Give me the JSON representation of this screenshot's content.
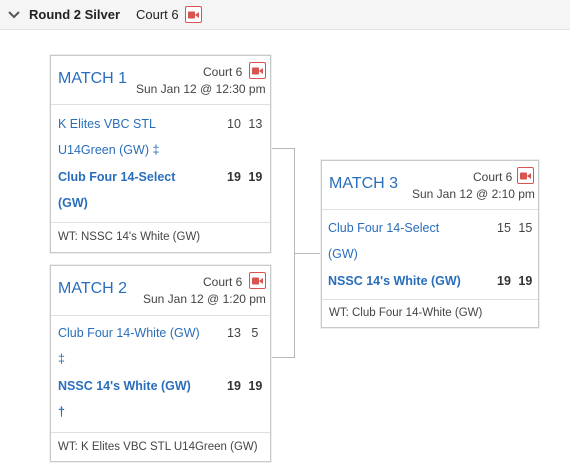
{
  "header": {
    "title": "Round 2 Silver",
    "court": "Court 6",
    "video_icon": "video-camera-icon",
    "accent": "#d9534f"
  },
  "matches": [
    {
      "title": "MATCH 1",
      "court": "Court 6",
      "date": "Sun Jan 12 @ 12:30 pm",
      "team1_line1": "K Elites VBC STL",
      "team1_line2": "U14Green (GW) ‡",
      "team1_s1": "10",
      "team1_s2": "13",
      "team2_line1": "Club Four 14-Select",
      "team2_line2": "(GW)",
      "team2_s1": "19",
      "team2_s2": "19",
      "work_team": "WT: NSSC 14's White (GW)"
    },
    {
      "title": "MATCH 2",
      "court": "Court 6",
      "date": "Sun Jan 12 @ 1:20 pm",
      "team1_line1": "Club Four 14-White (GW)",
      "team1_line2": "‡",
      "team1_s1": "13",
      "team1_s2": "5",
      "team2_line1": "NSSC 14's White (GW)",
      "team2_line2": "†",
      "team2_s1": "19",
      "team2_s2": "19",
      "work_team": "WT: K Elites VBC STL U14Green (GW)"
    },
    {
      "title": "MATCH 3",
      "court": "Court 6",
      "date": "Sun Jan 12 @ 2:10 pm",
      "team1_line1": "Club Four 14-Select",
      "team1_line2": "(GW)",
      "team1_s1": "15",
      "team1_s2": "15",
      "team2_line1": "NSSC 14's White (GW)",
      "team2_s1": "19",
      "team2_s2": "19",
      "work_team": "WT: Club Four 14-White (GW)"
    }
  ]
}
